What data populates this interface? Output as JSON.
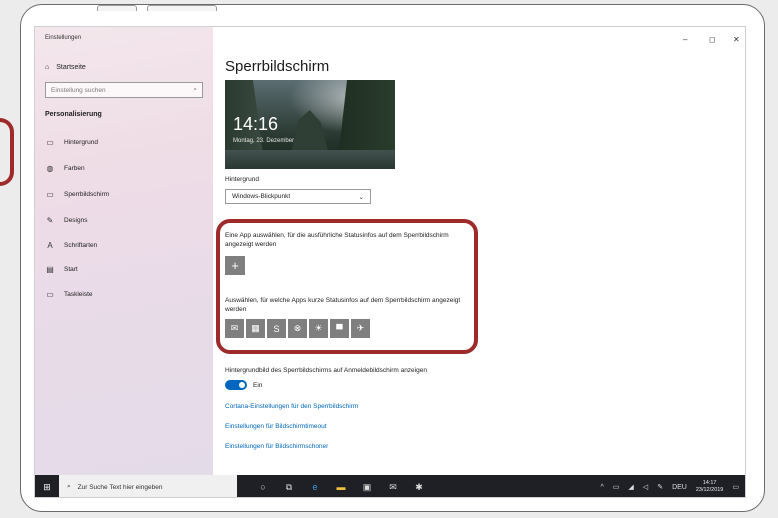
{
  "window": {
    "title": "Einstellungen",
    "controls": {
      "minimize": "–",
      "maximize": "◻",
      "close": "✕"
    }
  },
  "sidebar": {
    "home": {
      "label": "Startseite",
      "icon": "home-icon"
    },
    "search": {
      "placeholder": "Einstellung suchen",
      "icon": "search-icon"
    },
    "section": "Personalisierung",
    "items": [
      {
        "label": "Hintergrund",
        "icon": "image-icon"
      },
      {
        "label": "Farben",
        "icon": "palette-icon"
      },
      {
        "label": "Sperrbildschirm",
        "icon": "lockscreen-icon"
      },
      {
        "label": "Designs",
        "icon": "brush-icon"
      },
      {
        "label": "Schriftarten",
        "icon": "font-icon"
      },
      {
        "label": "Start",
        "icon": "start-icon"
      },
      {
        "label": "Taskleiste",
        "icon": "taskbar-icon"
      }
    ]
  },
  "main": {
    "title": "Sperrbildschirm",
    "preview": {
      "time": "14:16",
      "date": "Montag, 23. Dezember"
    },
    "background_label": "Hintergrund",
    "background_select": "Windows-Blickpunkt",
    "detail_app_text": "Eine App auswählen, für die ausführliche Statusinfos auf dem Sperrbildschirm angezeigt werden",
    "detail_app_button": "+",
    "quick_apps_text": "Auswählen, für welche Apps kurze Statusinfos auf dem Sperrbildschirm angezeigt werden",
    "quick_apps": [
      {
        "name": "mail-icon",
        "glyph": "✉"
      },
      {
        "name": "calendar-icon",
        "glyph": "▦"
      },
      {
        "name": "skype-icon",
        "glyph": "S"
      },
      {
        "name": "xbox-icon",
        "glyph": "⊗"
      },
      {
        "name": "weather-icon",
        "glyph": "☀"
      },
      {
        "name": "message-icon",
        "glyph": "▀"
      },
      {
        "name": "flight-icon",
        "glyph": "✈"
      }
    ],
    "show_bg_text": "Hintergrundbild des Sperrbildschirms auf Anmeldebildschirm anzeigen",
    "toggle_label": "Ein",
    "links": [
      "Cortana-Einstellungen für den Sperrbildschirm",
      "Einstellungen für Bildschirmtimeout",
      "Einstellungen für Bildschirmschoner"
    ]
  },
  "taskbar": {
    "search_placeholder": "Zur Suche Text hier eingeben",
    "language": "DEU",
    "time": "14:17",
    "date": "23/12/2019"
  },
  "colors": {
    "highlight": "#9e2b2b",
    "accent": "#0067c0",
    "taskbar": "#1f1f26"
  }
}
